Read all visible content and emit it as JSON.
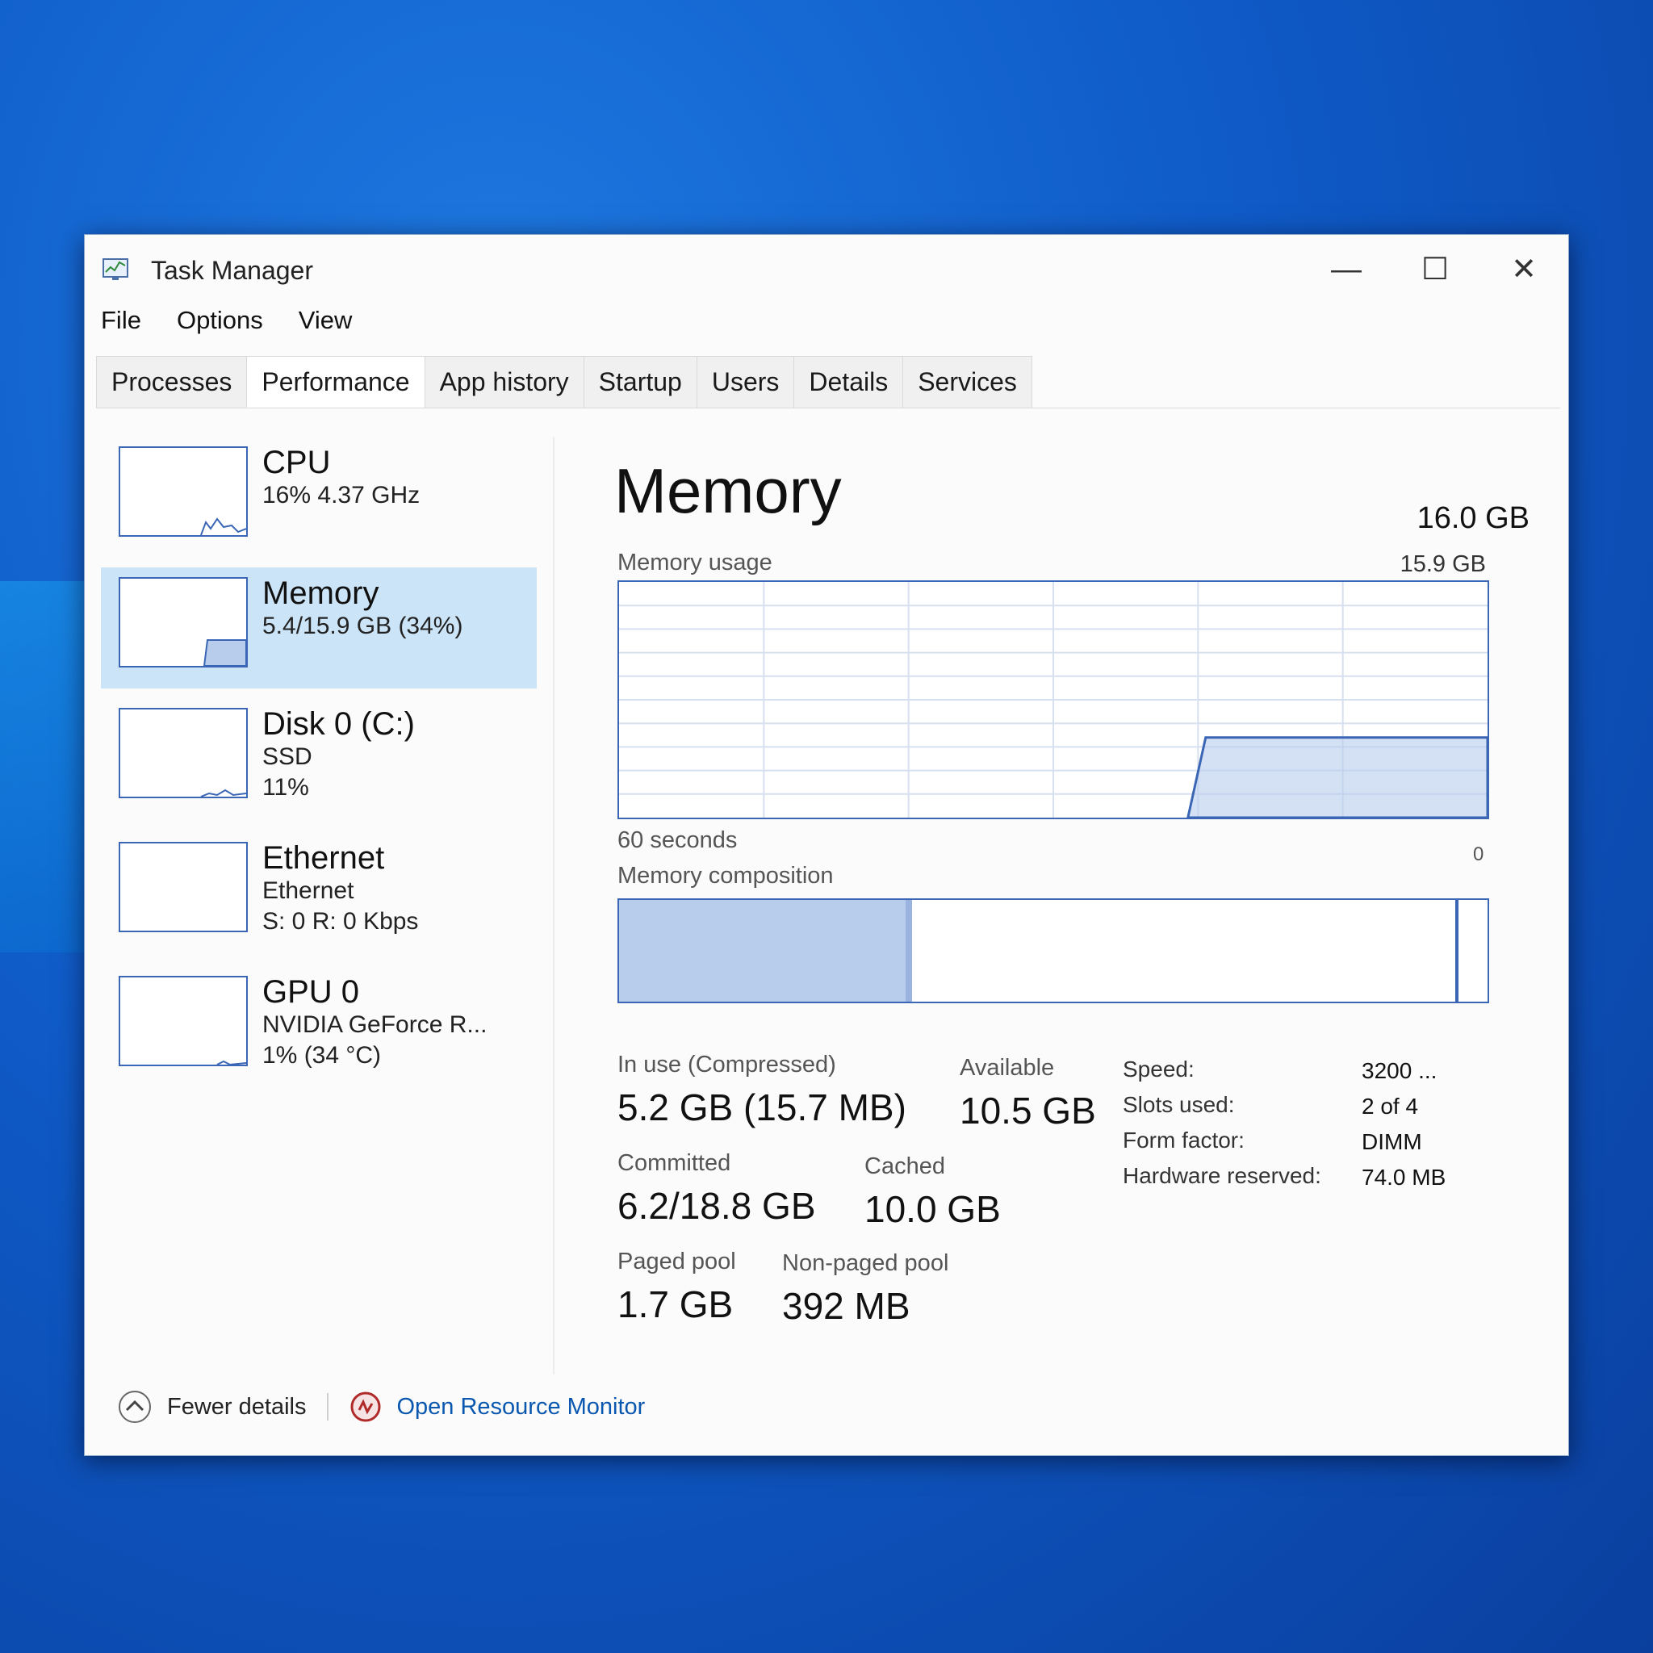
{
  "window": {
    "title": "Task Manager",
    "controls": {
      "minimize": "—",
      "maximize": "☐",
      "close": "✕"
    }
  },
  "menu": [
    "File",
    "Options",
    "View"
  ],
  "tabs": [
    "Processes",
    "Performance",
    "App history",
    "Startup",
    "Users",
    "Details",
    "Services"
  ],
  "active_tab": "Performance",
  "sidebar": {
    "cpu": {
      "title": "CPU",
      "line1": "16% 4.37 GHz"
    },
    "memory": {
      "title": "Memory",
      "line1": "5.4/15.9 GB (34%)"
    },
    "disk": {
      "title": "Disk 0 (C:)",
      "line1": "SSD",
      "line2": "11%"
    },
    "ethernet": {
      "title": "Ethernet",
      "line1": "Ethernet",
      "line2": "S: 0 R: 0 Kbps"
    },
    "gpu": {
      "title": "GPU 0",
      "line1": "NVIDIA GeForce R...",
      "line2": "1% (34 °C)"
    }
  },
  "main": {
    "title": "Memory",
    "total": "16.0 GB",
    "usage_label": "Memory usage",
    "usage_max": "15.9 GB",
    "time_label": "60 seconds",
    "zero_label": "0",
    "composition_label": "Memory composition",
    "composition_in_use_fraction": 0.33,
    "usage_history_fraction": 0.34,
    "stats": {
      "in_use_label": "In use (Compressed)",
      "in_use_value": "5.2 GB (15.7 MB)",
      "available_label": "Available",
      "available_value": "10.5 GB",
      "committed_label": "Committed",
      "committed_value": "6.2/18.8 GB",
      "cached_label": "Cached",
      "cached_value": "10.0 GB",
      "paged_label": "Paged pool",
      "paged_value": "1.7 GB",
      "nonpaged_label": "Non-paged pool",
      "nonpaged_value": "392 MB"
    },
    "specs": {
      "speed_label": "Speed:",
      "speed_value": "3200 ...",
      "slots_label": "Slots used:",
      "slots_value": "2 of 4",
      "form_label": "Form factor:",
      "form_value": "DIMM",
      "hw_label": "Hardware reserved:",
      "hw_value": "74.0 MB"
    }
  },
  "footer": {
    "fewer": "Fewer details",
    "monitor": "Open Resource Monitor"
  },
  "colors": {
    "graph_line": "#3a66b5",
    "selection": "#cce4f7",
    "link": "#0a57b0"
  },
  "icons": {
    "app": "task-manager-icon",
    "fewer": "chevron-up-icon",
    "monitor": "resource-monitor-icon"
  }
}
